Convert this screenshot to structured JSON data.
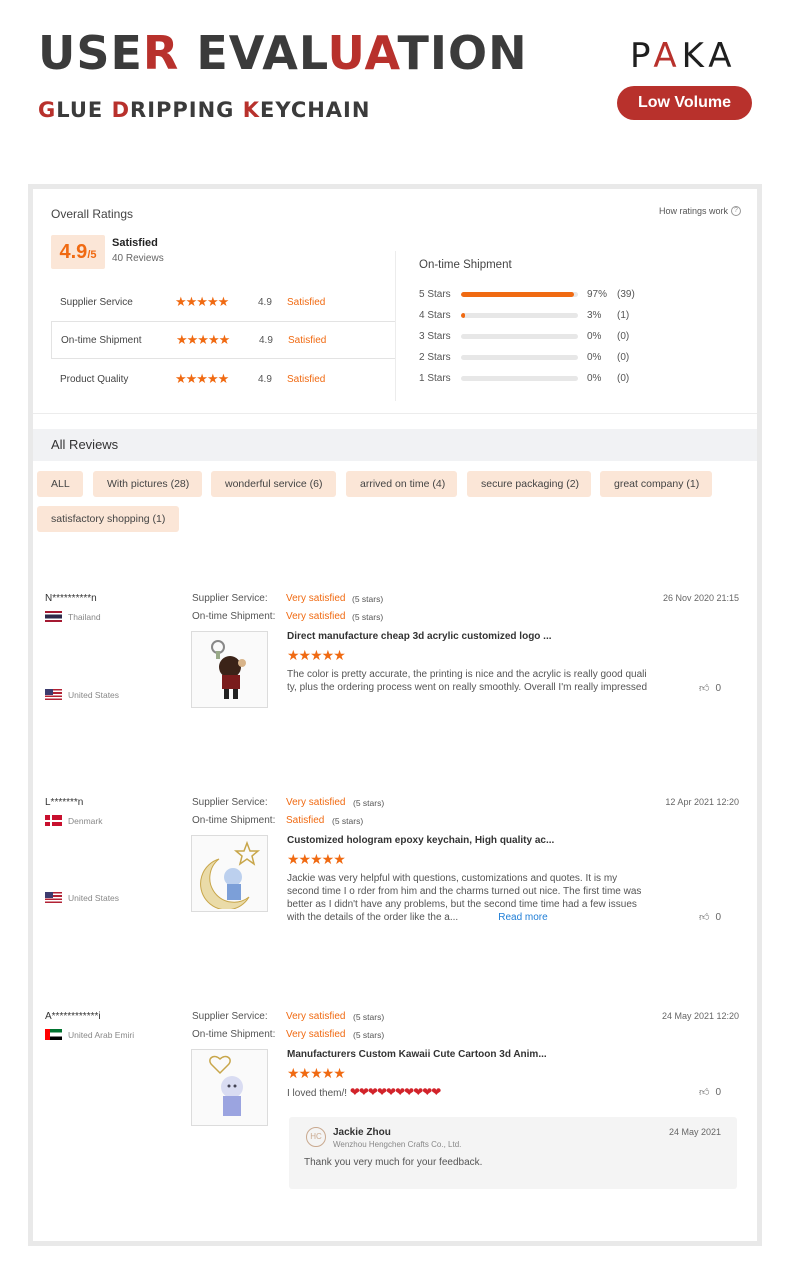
{
  "header": {
    "title_parts": [
      "USE",
      "R",
      " EVAL",
      "UA",
      "TION"
    ],
    "subtitle_parts": [
      "G",
      "LUE ",
      "D",
      "RIPPING ",
      "K",
      "EYCHAIN"
    ],
    "brand_parts": [
      "P",
      "A",
      "K",
      "A"
    ],
    "volume_label": "Low Volume"
  },
  "ratings": {
    "title": "Overall Ratings",
    "how_link": "How ratings work",
    "how_icon": "?",
    "score": "4.9",
    "score_max": "/5",
    "score_label": "Satisfied",
    "review_count": "40 Reviews",
    "metrics": [
      {
        "name": "Supplier Service",
        "stars": "★★★★★",
        "score": "4.9",
        "label": "Satisfied"
      },
      {
        "name": "On-time Shipment",
        "stars": "★★★★★",
        "score": "4.9",
        "label": "Satisfied"
      },
      {
        "name": "Product Quality",
        "stars": "★★★★★",
        "score": "4.9",
        "label": "Satisfied"
      }
    ],
    "shipment": {
      "title": "On-time Shipment",
      "rows": [
        {
          "label": "5 Stars",
          "pct": "97%",
          "count": "(39)",
          "fraction": 0.97
        },
        {
          "label": "4 Stars",
          "pct": "3%",
          "count": "(1)",
          "fraction": 0.03
        },
        {
          "label": "3 Stars",
          "pct": "0%",
          "count": "(0)",
          "fraction": 0
        },
        {
          "label": "2 Stars",
          "pct": "0%",
          "count": "(0)",
          "fraction": 0
        },
        {
          "label": "1 Stars",
          "pct": "0%",
          "count": "(0)",
          "fraction": 0
        }
      ]
    }
  },
  "reviews_section": {
    "title": "All Reviews",
    "tags": [
      "ALL",
      "With pictures (28)",
      "wonderful service (6)",
      "arrived on time (4)",
      "secure packaging (2)",
      "great company (1)",
      "satisfactory shopping (1)"
    ]
  },
  "reviews": [
    {
      "name": "N**********n",
      "country": "Thailand",
      "ship_country": "United States",
      "service_label": "Supplier Service:",
      "service_val": "Very satisfied",
      "service_stars": "(5 stars)",
      "shipment_label": "On-time Shipment:",
      "shipment_val": "Very satisfied",
      "shipment_stars": "(5 stars)",
      "date": "26 Nov 2020 21:15",
      "product": "Direct manufacture cheap 3d acrylic customized logo ...",
      "stars": "★★★★★",
      "text": "The color is pretty accurate, the printing is nice and the acrylic is really good quali ty, plus the ordering process went on really smoothly. Overall I'm really impressed",
      "likes": "0"
    },
    {
      "name": "L*******n",
      "country": "Denmark",
      "ship_country": "United States",
      "service_label": "Supplier Service:",
      "service_val": "Very satisfied",
      "service_stars": "(5 stars)",
      "shipment_label": "On-time Shipment:",
      "shipment_val": "Satisfied",
      "shipment_stars": "(5 stars)",
      "date": "12 Apr 2021 12:20",
      "product": "Customized hologram epoxy keychain, High quality ac...",
      "stars": "★★★★★",
      "text": "Jackie was very helpful with questions, customizations and quotes. It is my second time I o rder from him and the charms turned out nice. The first time was better as I didn't have any problems, but the second time time had a few issues with the details of the order like the a...",
      "read_more": "Read more",
      "likes": "0"
    },
    {
      "name": "A************i",
      "country": "United Arab Emiri",
      "service_label": "Supplier Service:",
      "service_val": "Very satisfied",
      "service_stars": "(5 stars)",
      "shipment_label": "On-time Shipment:",
      "shipment_val": "Very satisfied",
      "shipment_stars": "(5 stars)",
      "date": "24 May 2021 12:20",
      "product": "Manufacturers Custom Kawaii Cute Cartoon 3d Anim...",
      "stars": "★★★★★",
      "text": "I loved them/!",
      "hearts": "❤❤❤❤❤❤❤❤❤❤",
      "likes": "0",
      "reply": {
        "logo": "HC",
        "name": "Jackie Zhou",
        "company": "Wenzhou Hengchen Crafts Co., Ltd.",
        "date": "24 May 2021",
        "text": "Thank you very much for your feedback."
      }
    }
  ],
  "colors": {
    "accent": "#f06a12",
    "brand_red": "#b8312c",
    "tag_bg": "#fbe6d7"
  }
}
